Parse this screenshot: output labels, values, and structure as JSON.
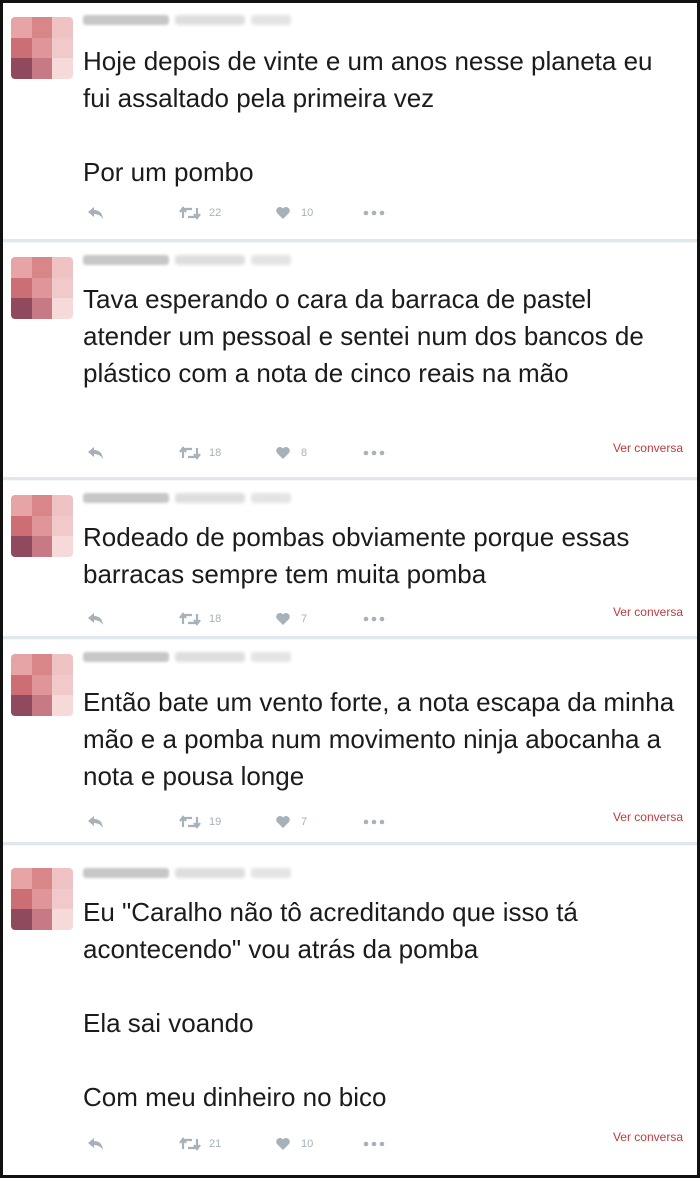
{
  "colors": {
    "text": "#1b1b1b",
    "action_icon": "#a6b1ba",
    "link_red": "#c1393b",
    "frame_border": "#111111",
    "divider": "#e1e8ed"
  },
  "icons": {
    "reply": "reply-arrow-icon",
    "retweet": "retweet-icon",
    "like": "heart-icon",
    "more": "more-dots-icon"
  },
  "tweets": [
    {
      "text": "Hoje depois de vinte e um anos nesse planeta eu fui assaltado pela primeira vez\n\nPor um pombo",
      "retweets": "22",
      "likes": "10"
    },
    {
      "text": "Tava esperando o cara da barraca de pastel atender um pessoal e sentei num dos bancos de plástico com a nota de cinco reais na mão",
      "retweets": "18",
      "likes": "8",
      "ver_conversa": "Ver conversa"
    },
    {
      "text": "Rodeado de pombas obviamente porque essas barracas sempre tem muita pomba",
      "retweets": "18",
      "likes": "7",
      "ver_conversa": "Ver conversa"
    },
    {
      "text": "Então bate um vento forte, a nota escapa da minha mão e a pomba num movimento ninja abocanha a nota e pousa longe",
      "retweets": "19",
      "likes": "7",
      "ver_conversa": "Ver conversa"
    },
    {
      "text": "Eu \"Caralho não tô acreditando que isso tá acontecendo\" vou atrás da pomba\n\nEla sai voando\n\nCom meu dinheiro no bico",
      "retweets": "21",
      "likes": "10",
      "ver_conversa": "Ver conversa"
    }
  ]
}
